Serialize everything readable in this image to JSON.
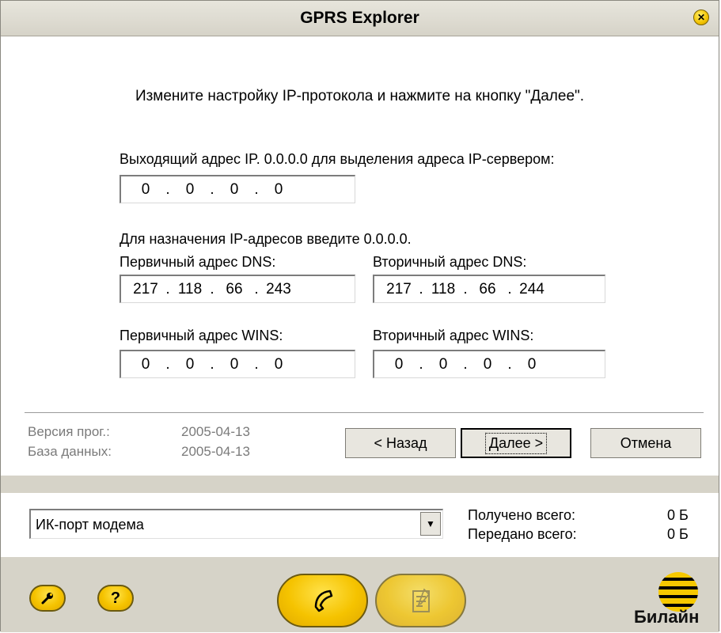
{
  "window": {
    "title": "GPRS Explorer"
  },
  "instruction": "Измените настройку IP-протокола и нажмите на кнопку \"Далее\".",
  "outgoing_ip": {
    "label": "Выходящий адрес IP. 0.0.0.0 для выделения адреса IP-сервером:",
    "value": [
      "0",
      "0",
      "0",
      "0"
    ]
  },
  "dns_hint": "Для назначения IP-адресов введите 0.0.0.0.",
  "dns": {
    "primary": {
      "label": "Первичный адрес DNS:",
      "value": [
        "217",
        "118",
        "66",
        "243"
      ]
    },
    "secondary": {
      "label": "Вторичный адрес DNS:",
      "value": [
        "217",
        "118",
        "66",
        "244"
      ]
    }
  },
  "wins": {
    "primary": {
      "label": "Первичный адрес WINS:",
      "value": [
        "0",
        "0",
        "0",
        "0"
      ]
    },
    "secondary": {
      "label": "Вторичный адрес WINS:",
      "value": [
        "0",
        "0",
        "0",
        "0"
      ]
    }
  },
  "version": {
    "program_label": "Версия прог.:",
    "program_value": "2005-04-13",
    "database_label": "База данных:",
    "database_value": "2005-04-13"
  },
  "buttons": {
    "back": "< Назад",
    "next": "Далее >",
    "cancel": "Отмена"
  },
  "connection": {
    "selected": "ИК-порт модема"
  },
  "stats": {
    "received_label": "Получено всего:",
    "received_value": "0 Б",
    "sent_label": "Передано всего:",
    "sent_value": "0 Б"
  },
  "logo": {
    "text": "Билайн"
  },
  "icons": [
    "close-icon",
    "settings-icon",
    "help-icon",
    "phone-icon",
    "notepad-icon",
    "dropdown-arrow-icon"
  ],
  "colors": {
    "accent": "#f5c300",
    "panel": "#d6d3c8"
  }
}
